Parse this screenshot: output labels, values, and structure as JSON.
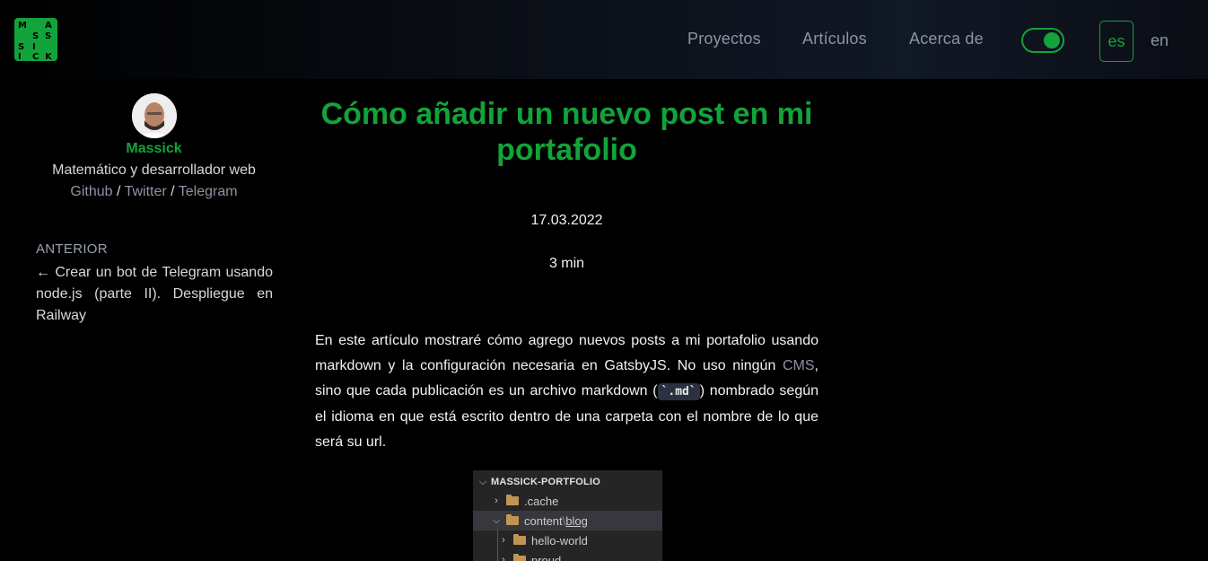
{
  "header": {
    "logo_text": "MASSICK",
    "nav": [
      "Proyectos",
      "Artículos",
      "Acerca de"
    ],
    "theme_toggle": "on",
    "languages": {
      "active": "es",
      "other": "en"
    }
  },
  "sidebar": {
    "author_name": "Massick",
    "author_role": "Matemático y desarrollador web",
    "links": [
      "Github",
      "Twitter",
      "Telegram"
    ],
    "separator": "/",
    "prev_label": "ANTERIOR",
    "prev_post": "← Crear un bot de Telegram usando node.js (parte II). Despliegue en Railway"
  },
  "post": {
    "title": "Cómo añadir un nuevo post en mi portafolio",
    "date": "17.03.2022",
    "read_time": "3 min",
    "body": {
      "p1": "En este artículo mostraré cómo agrego nuevos posts a mi portafolio usando markdown y la configuración necesaria en GatsbyJS. No uso ningún ",
      "link_cms": "CMS",
      "p2": ", sino que cada publicación es un archivo markdown (",
      "code": "`.md`",
      "p3": ") nombrado según el idioma en que está escrito dentro de una carpeta con el nombre de lo que será su url."
    }
  },
  "explorer": {
    "header": "MASSICK-PORTFOLIO",
    "rows": [
      ".cache",
      "content",
      "blog",
      "hello-world",
      "proud"
    ],
    "path_separator": "\\"
  },
  "colors": {
    "accent": "#12a33a",
    "muted": "#8b94a3"
  }
}
